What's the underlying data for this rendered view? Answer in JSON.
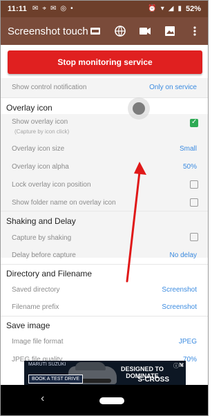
{
  "status_bar": {
    "time": "11:11",
    "battery_pct": "52%"
  },
  "toolbar": {
    "title": "Screenshot touch"
  },
  "buttons": {
    "stop_monitoring": "Stop monitoring service"
  },
  "rows": {
    "control_notification": {
      "label": "Show control notification",
      "value": "Only on service"
    },
    "overlay_icon_section": "Overlay icon",
    "show_overlay_icon": {
      "label": "Show overlay icon",
      "sub": "(Capture by icon click)",
      "checked": true
    },
    "overlay_icon_size": {
      "label": "Overlay icon size",
      "value": "Small"
    },
    "overlay_icon_alpha": {
      "label": "Overlay icon alpha",
      "value": "50%"
    },
    "lock_overlay_position": {
      "label": "Lock overlay icon position",
      "checked": false
    },
    "show_folder_name": {
      "label": "Show folder name on overlay icon",
      "checked": false
    },
    "shaking_section": "Shaking and Delay",
    "capture_by_shaking": {
      "label": "Capture by shaking",
      "checked": false
    },
    "delay_before_capture": {
      "label": "Delay before capture",
      "value": "No delay"
    },
    "directory_section": "Directory and Filename",
    "saved_directory": {
      "label": "Saved directory",
      "value": "Screenshot"
    },
    "filename_prefix": {
      "label": "Filename prefix",
      "value": "Screenshot"
    },
    "save_image_section": "Save image",
    "image_file_format": {
      "label": "Image file format",
      "value": "JPEG"
    },
    "jpeg_file_quality": {
      "label": "JPEG file quality",
      "value": "70%"
    }
  },
  "ad": {
    "brand": "MARUTI SUZUKI",
    "cta": "BOOK A TEST DRIVE",
    "headline_line1": "DESIGNED TO",
    "headline_line2": "DOMINATE",
    "model": "S-CROSS",
    "corner": "N"
  },
  "colors": {
    "status_bar_bg": "#6d3f2b",
    "toolbar_bg": "#7a4b3a",
    "stop_button_bg": "#e02020",
    "link_blue": "#3b8be0",
    "checkbox_green": "#2eaa54",
    "annotation_red": "#e01818"
  },
  "icons": [
    "new-badge-icon",
    "globe-icon",
    "video-icon",
    "image-icon",
    "more-vert-icon",
    "back-icon",
    "home-pill-icon"
  ]
}
